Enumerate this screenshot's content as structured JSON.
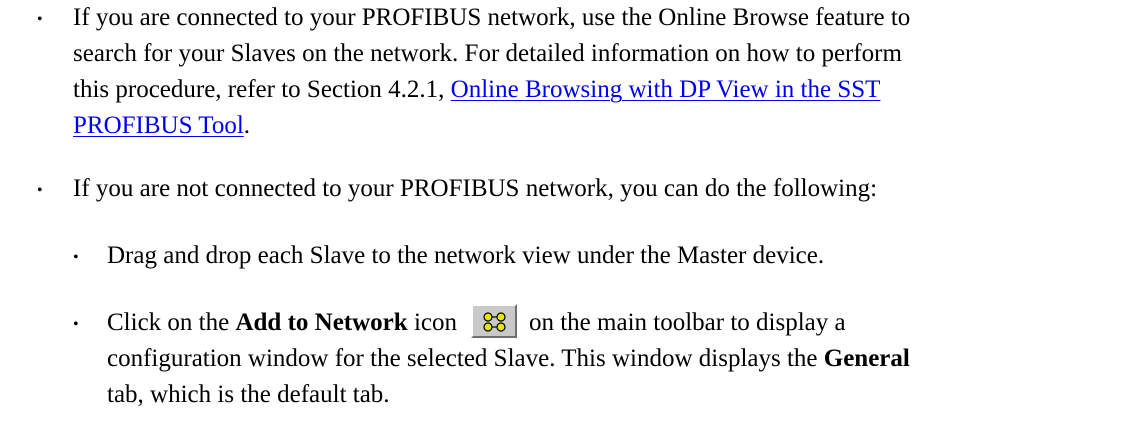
{
  "bullets": {
    "first": {
      "text_before": "If you are connected to your PROFIBUS network, use the Online Browse feature to",
      "line2": "search for your Slaves on the network. For detailed information on how to perform",
      "line3_before_link": "this procedure, refer to Section 4.2.1, ",
      "link_line1": "Online Browsing with DP View in the SST",
      "link_line2": "PROFIBUS Tool",
      "after_link": "."
    },
    "second": {
      "text": "If you are not connected to your PROFIBUS network, you can do the following:"
    },
    "sub1": {
      "text": "Drag and drop each Slave to the network view under the Master device."
    },
    "sub2": {
      "before_bold": "Click on the ",
      "bold": "Add to Network",
      "after_bold": " icon",
      "after_icon": "on the main toolbar to display a",
      "line2_before_bold": "configuration window for the selected Slave. This window displays the ",
      "line2_bold": "General",
      "line3": "tab, which is the default tab."
    }
  },
  "icons": {
    "add_to_network": "network-nodes-icon"
  },
  "colors": {
    "link": "#0000ee",
    "icon_face": "#c9c9c9",
    "icon_glyph": "#e6e600"
  }
}
